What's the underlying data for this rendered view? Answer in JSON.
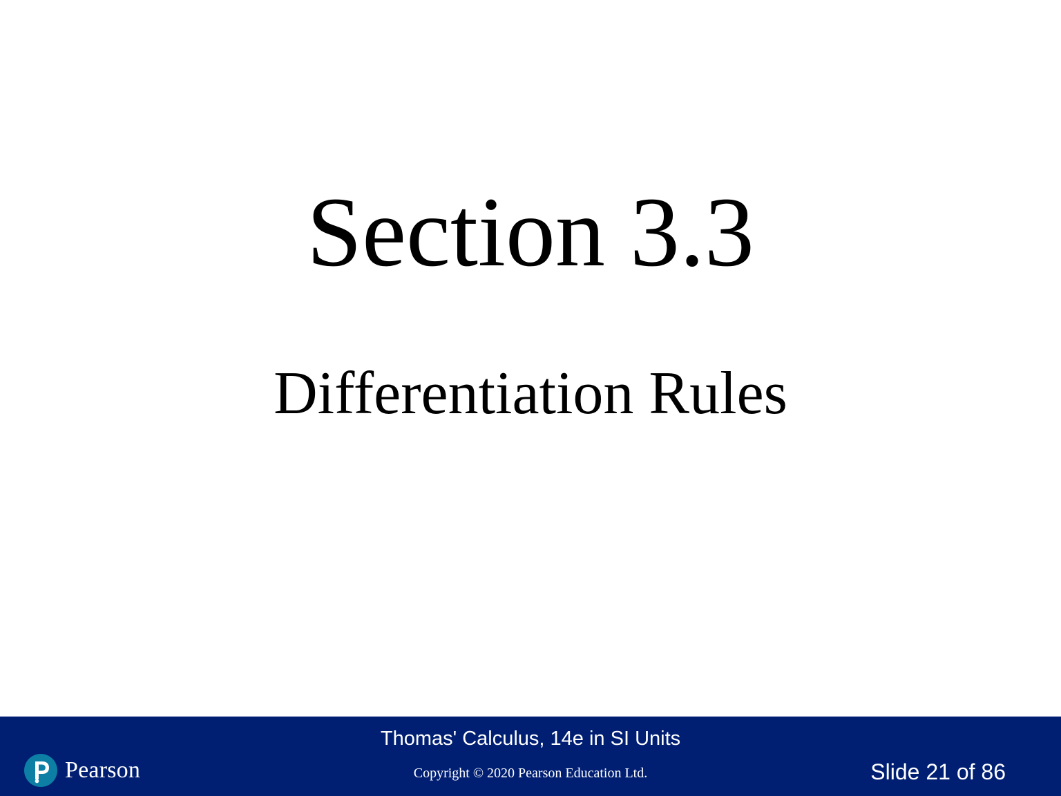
{
  "slide": {
    "title": "Section 3.3",
    "subtitle": "Differentiation Rules"
  },
  "footer": {
    "book_title": "Thomas' Calculus, 14e in SI Units",
    "copyright": "Copyright © 2020 Pearson Education Ltd.",
    "slide_number": "Slide 21 of 86",
    "logo_text": "Pearson",
    "logo_icon": "pearson-p-icon",
    "background_color": "#001f73",
    "logo_color": "#0d7fa5"
  }
}
